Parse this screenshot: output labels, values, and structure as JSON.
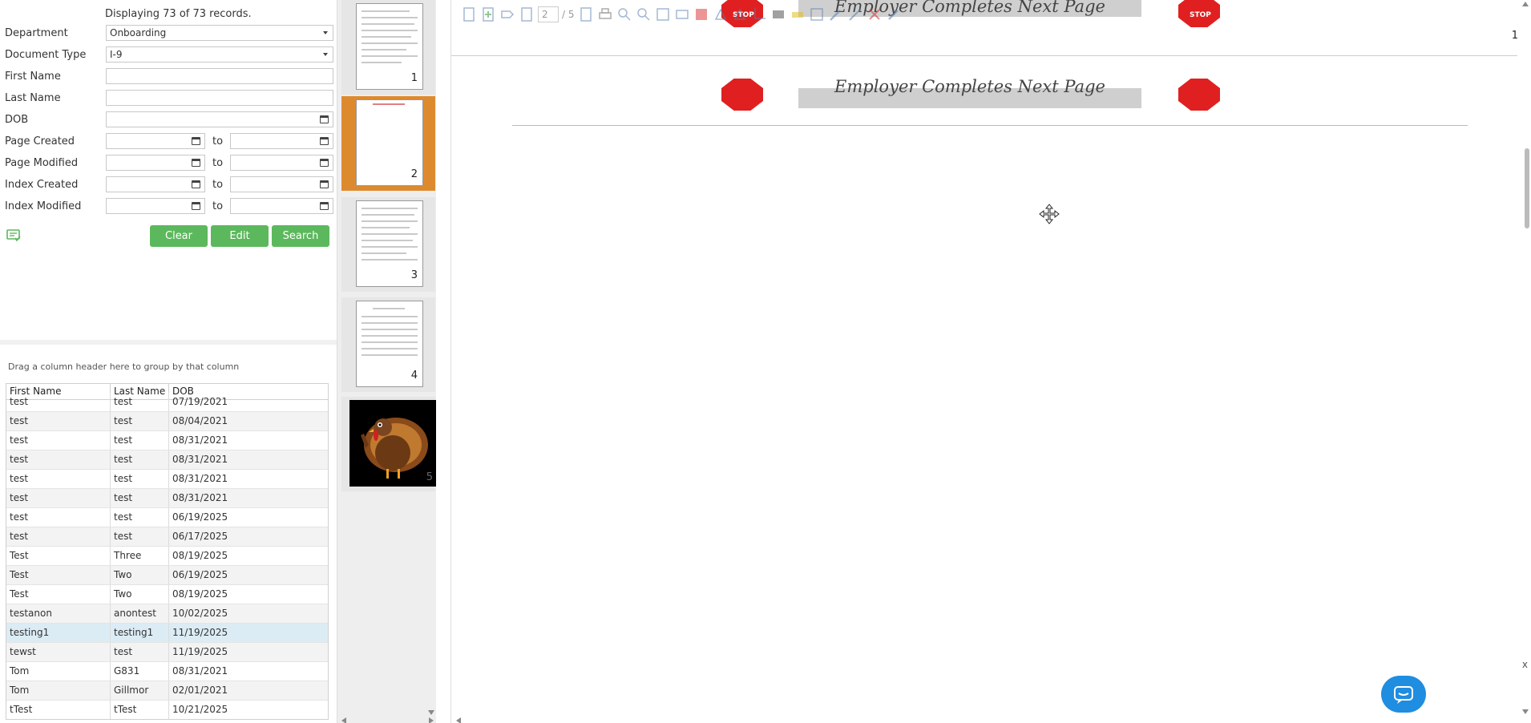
{
  "search": {
    "records_info": "Displaying 73 of 73 records.",
    "department_label": "Department",
    "department_value": "Onboarding",
    "doctype_label": "Document Type",
    "doctype_value": "I-9",
    "first_name_label": "First Name",
    "first_name_value": "",
    "last_name_label": "Last Name",
    "last_name_value": "",
    "dob_label": "DOB",
    "dob_value": "",
    "page_created_label": "Page Created",
    "page_modified_label": "Page Modified",
    "index_created_label": "Index Created",
    "index_modified_label": "Index Modified",
    "to_label": "to",
    "clear_label": "Clear",
    "edit_label": "Edit",
    "search_label": "Search",
    "button_color": "#5cb85c"
  },
  "grid": {
    "group_hint": "Drag a column header here to group by that column",
    "headers": [
      "First Name",
      "Last Name",
      "DOB"
    ],
    "rows": [
      {
        "first": "test",
        "last": "test",
        "dob": "07/19/2021"
      },
      {
        "first": "test",
        "last": "test",
        "dob": "08/04/2021"
      },
      {
        "first": "test",
        "last": "test",
        "dob": "08/31/2021"
      },
      {
        "first": "test",
        "last": "test",
        "dob": "08/31/2021"
      },
      {
        "first": "test",
        "last": "test",
        "dob": "08/31/2021"
      },
      {
        "first": "test",
        "last": "test",
        "dob": "08/31/2021"
      },
      {
        "first": "test",
        "last": "test",
        "dob": "06/19/2025"
      },
      {
        "first": "test",
        "last": "test",
        "dob": "06/17/2025"
      },
      {
        "first": "Test",
        "last": "Three",
        "dob": "08/19/2025"
      },
      {
        "first": "Test",
        "last": "Two",
        "dob": "06/19/2025"
      },
      {
        "first": "Test",
        "last": "Two",
        "dob": "08/19/2025"
      },
      {
        "first": "testanon",
        "last": "anontest",
        "dob": "10/02/2025"
      },
      {
        "first": "testing1",
        "last": "testing1",
        "dob": "11/19/2025",
        "selected": true
      },
      {
        "first": "tewst",
        "last": "test",
        "dob": "11/19/2025"
      },
      {
        "first": "Tom",
        "last": "G831",
        "dob": "08/31/2021"
      },
      {
        "first": "Tom",
        "last": "Gillmor",
        "dob": "02/01/2021"
      },
      {
        "first": "tTest",
        "last": "tTest",
        "dob": "10/21/2025"
      }
    ]
  },
  "thumbnails": {
    "pages": [
      "1",
      "2",
      "3",
      "4",
      "5"
    ],
    "active_page": "2",
    "active_color": "#dd8a2e"
  },
  "viewer": {
    "current_page": "2",
    "total_pages": "/ 5",
    "page_number_label": "1",
    "stop_text": "STOP",
    "banner_text": "Employer Completes Next Page",
    "stop_color": "#e02020",
    "chat_color": "#1f8de0",
    "close_label": "x"
  }
}
